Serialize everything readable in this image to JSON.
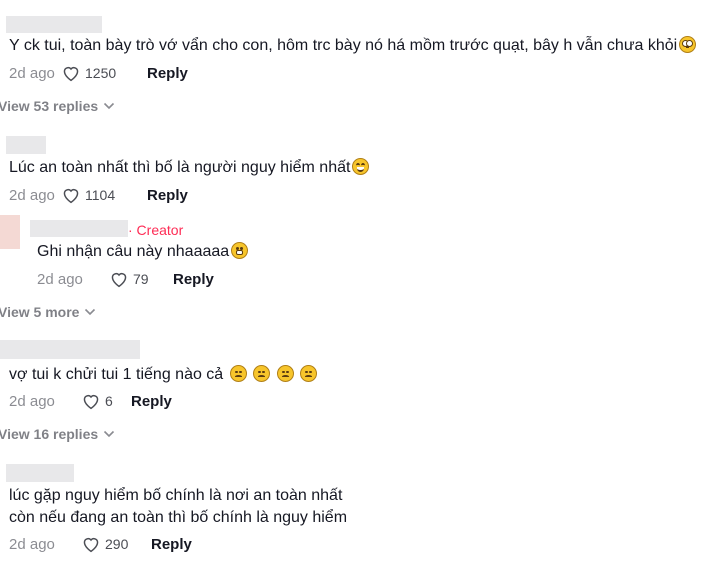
{
  "comments": [
    {
      "text": "Y ck tui, toàn bày trò vớ vẩn cho con, hôm trc bày nó há mồm trước quạt, bây h vẫn chưa khỏi",
      "emojis": [
        "face-with-rolling-eyes"
      ],
      "date": "2d ago",
      "likes": "1250",
      "reply": "Reply",
      "view_more": "View 53 replies"
    },
    {
      "text": "Lúc an toàn nhất thì bố là người nguy hiểm nhất",
      "emojis": [
        "face-with-tears-of-joy"
      ],
      "date": "2d ago",
      "likes": "1104",
      "reply": "Reply"
    },
    {
      "creator_label": "· Creator",
      "text": "Ghi nhận câu này nhaaaaa",
      "emojis": [
        "grinning-face"
      ],
      "date": "2d ago",
      "likes": "79",
      "reply": "Reply",
      "view_more": "View 5 more"
    },
    {
      "text": "vợ tui k chửi tui 1 tiếng nào cả",
      "emojis": [
        "pensive-face",
        "pensive-face",
        "pensive-face",
        "pensive-face"
      ],
      "date": "2d ago",
      "likes": "6",
      "reply": "Reply",
      "view_more": "View 16 replies"
    },
    {
      "text_line1": "lúc gặp nguy hiểm bố chính là nơi an toàn nhất",
      "text_line2": "còn nếu đang an toàn thì bố chính là nguy hiểm",
      "date": "2d ago",
      "likes": "290",
      "reply": "Reply"
    }
  ],
  "icons": {
    "like": "heart-outline-icon",
    "expand": "chevron-down-icon"
  },
  "colors": {
    "creator": "#fe2c55",
    "muted": "#8a8b91",
    "text": "#161823"
  }
}
